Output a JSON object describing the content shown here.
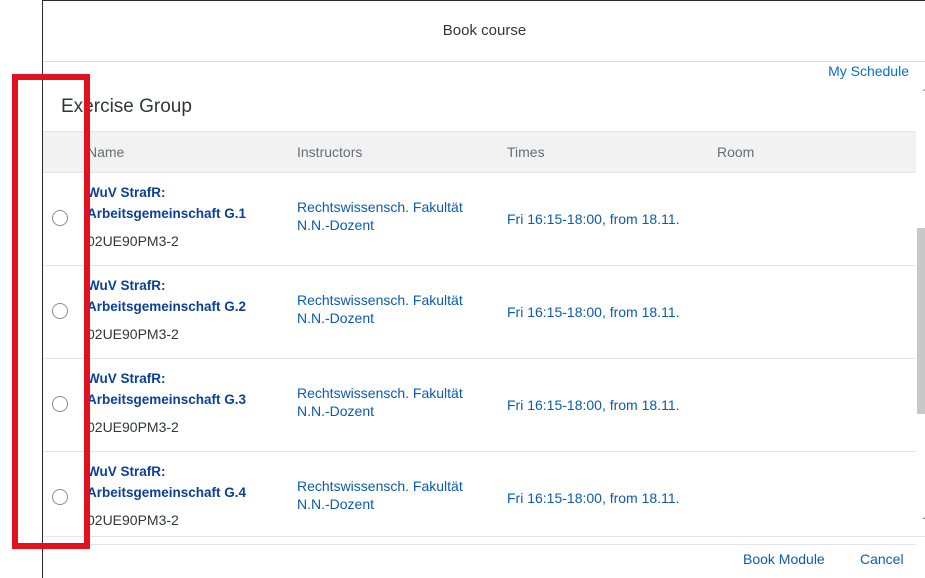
{
  "dialog": {
    "title": "Book course",
    "my_schedule": "My Schedule",
    "section_title": "Exercise Group"
  },
  "table": {
    "columns": [
      "Name",
      "Instructors",
      "Times",
      "Room"
    ],
    "rows": [
      {
        "name_line1": "WuV StrafR:",
        "name_line2": "Arbeitsgemeinschaft G.1",
        "code": "02UE90PM3-2",
        "instructor1": "Rechtswissensch. Fakultät",
        "instructor2": "N.N.-Dozent",
        "times": "Fri 16:15-18:00, from 18.11.",
        "room": ""
      },
      {
        "name_line1": "WuV StrafR:",
        "name_line2": "Arbeitsgemeinschaft G.2",
        "code": "02UE90PM3-2",
        "instructor1": "Rechtswissensch. Fakultät",
        "instructor2": "N.N.-Dozent",
        "times": "Fri 16:15-18:00, from 18.11.",
        "room": ""
      },
      {
        "name_line1": "WuV StrafR:",
        "name_line2": "Arbeitsgemeinschaft G.3",
        "code": "02UE90PM3-2",
        "instructor1": "Rechtswissensch. Fakultät",
        "instructor2": "N.N.-Dozent",
        "times": "Fri 16:15-18:00, from 18.11.",
        "room": ""
      },
      {
        "name_line1": "WuV StrafR:",
        "name_line2": "Arbeitsgemeinschaft G.4",
        "code": "02UE90PM3-2",
        "instructor1": "Rechtswissensch. Fakultät",
        "instructor2": "N.N.-Dozent",
        "times": "Fri 16:15-18:00, from 18.11.",
        "room": ""
      }
    ]
  },
  "footer": {
    "book_module": "Book Module",
    "cancel": "Cancel"
  },
  "colors": {
    "link": "#0a5bb5",
    "highlight": "#e3101f"
  }
}
